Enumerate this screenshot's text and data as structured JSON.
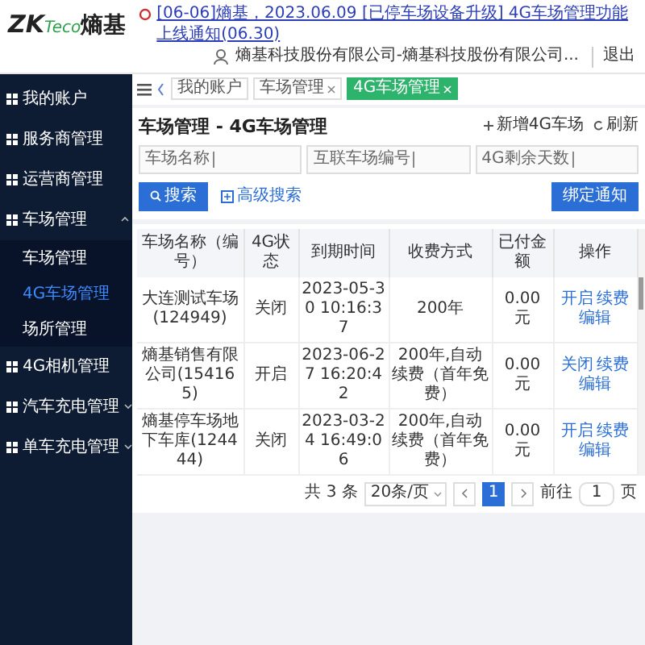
{
  "header": {
    "logo": {
      "brand": "ZK",
      "suffix": "Teco",
      "cn": "熵基"
    },
    "notice": "[06-06]熵基，2023.06.09 [已停车场设备升级] 4G车场管理功能上线通知(06.30)",
    "user": "熵基科技股份有限公司-熵基科技股份有限公司...",
    "logout": "退出"
  },
  "sidebar": {
    "items": [
      {
        "label": "我的账户"
      },
      {
        "label": "服务商管理"
      },
      {
        "label": "运营商管理"
      },
      {
        "label": "车场管理",
        "expanded": true,
        "children": [
          {
            "label": "车场管理",
            "selected": false
          },
          {
            "label": "4G车场管理",
            "selected": true
          },
          {
            "label": "场所管理",
            "selected": false
          }
        ]
      },
      {
        "label": "4G相机管理"
      },
      {
        "label": "汽车充电管理",
        "expanded": false
      },
      {
        "label": "单车充电管理",
        "expanded": false
      }
    ]
  },
  "tabs": [
    {
      "label": "我的账户",
      "closable": false,
      "selected": false
    },
    {
      "label": "车场管理",
      "closable": true,
      "selected": false
    },
    {
      "label": "4G车场管理",
      "closable": true,
      "selected": true
    }
  ],
  "page": {
    "title": "车场管理 - 4G车场管理",
    "actions": [
      "新增4G车场",
      "刷新"
    ],
    "filters": [
      {
        "label": "车场名称"
      },
      {
        "label": "互联车场编号"
      },
      {
        "label": "4G剩余天数"
      }
    ],
    "search_button": "搜索",
    "advanced_search": "高级搜索",
    "notify_button": "绑定通知"
  },
  "table": {
    "columns": [
      "车场名称（编号）",
      "4G状态",
      "到期时间",
      "收费方式",
      "已付金额",
      "操作"
    ],
    "rows": [
      {
        "name": "大连测试车场(124949)",
        "status": "关闭",
        "expires": "2023-05-30 10:16:37",
        "billing": "200年",
        "paid": "0.00 元",
        "actions": [
          "开启",
          "续费",
          "编辑"
        ]
      },
      {
        "name": "熵基销售有限公司(154165)",
        "status": "开启",
        "expires": "2023-06-27 16:20:42",
        "billing": "200年,自动续费（首年免费）",
        "paid": "0.00 元",
        "actions": [
          "关闭",
          "续费",
          "编辑"
        ]
      },
      {
        "name": "熵基停车场地下车库(124444)",
        "status": "关闭",
        "expires": "2023-03-24 16:49:06",
        "billing": "200年,自动续费（首年免费）",
        "paid": "0.00 元",
        "actions": [
          "开启",
          "续费",
          "编辑"
        ]
      }
    ]
  },
  "pagination": {
    "total": "共 3 条",
    "page_size": "20条/页",
    "pages": [
      {
        "label": "1",
        "selected": true
      }
    ],
    "goto_label": "前往",
    "goto_value": "1",
    "goto_suffix": "页"
  }
}
